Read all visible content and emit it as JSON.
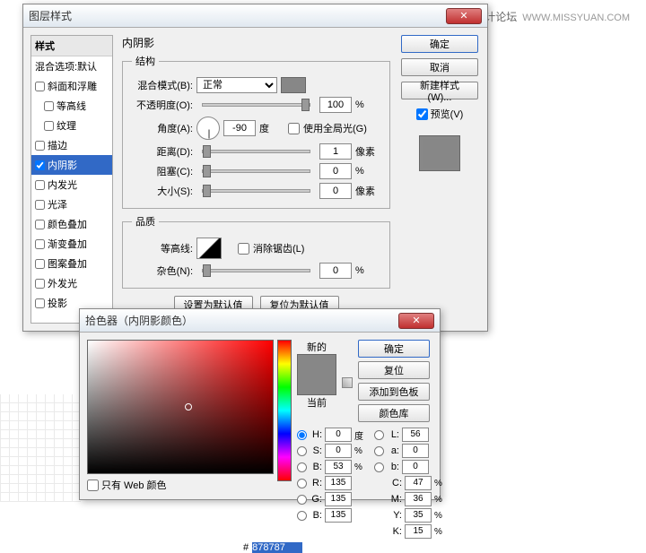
{
  "watermark": {
    "cn": "思缘设计论坛",
    "url": "WWW.MISSYUAN.COM"
  },
  "layerStyle": {
    "title": "图层样式",
    "stylesHeader": "样式",
    "items": [
      {
        "label": "混合选项:默认",
        "checked": null
      },
      {
        "label": "斜面和浮雕",
        "checked": false
      },
      {
        "label": "等高线",
        "checked": false,
        "indent": true
      },
      {
        "label": "纹理",
        "checked": false,
        "indent": true
      },
      {
        "label": "描边",
        "checked": false
      },
      {
        "label": "内阴影",
        "checked": true,
        "active": true
      },
      {
        "label": "内发光",
        "checked": false
      },
      {
        "label": "光泽",
        "checked": false
      },
      {
        "label": "颜色叠加",
        "checked": false
      },
      {
        "label": "渐变叠加",
        "checked": false
      },
      {
        "label": "图案叠加",
        "checked": false
      },
      {
        "label": "外发光",
        "checked": false
      },
      {
        "label": "投影",
        "checked": false
      }
    ],
    "panelTitle": "内阴影",
    "structure": {
      "legend": "结构",
      "blendMode": {
        "label": "混合模式(B):",
        "value": "正常"
      },
      "opacity": {
        "label": "不透明度(O):",
        "value": "100",
        "unit": "%"
      },
      "angle": {
        "label": "角度(A):",
        "value": "-90",
        "unit": "度",
        "globalLabel": "使用全局光(G)"
      },
      "distance": {
        "label": "距离(D):",
        "value": "1",
        "unit": "像素"
      },
      "choke": {
        "label": "阻塞(C):",
        "value": "0",
        "unit": "%"
      },
      "size": {
        "label": "大小(S):",
        "value": "0",
        "unit": "像素"
      }
    },
    "quality": {
      "legend": "品质",
      "contour": {
        "label": "等高线:",
        "antiAlias": "消除锯齿(L)"
      },
      "noise": {
        "label": "杂色(N):",
        "value": "0",
        "unit": "%"
      }
    },
    "defaults": {
      "set": "设置为默认值",
      "reset": "复位为默认值"
    },
    "buttons": {
      "ok": "确定",
      "cancel": "取消",
      "newStyle": "新建样式(W)...",
      "preview": "预览(V)"
    }
  },
  "colorPicker": {
    "title": "拾色器（内阴影颜色）",
    "newLabel": "新的",
    "currentLabel": "当前",
    "buttons": {
      "ok": "确定",
      "reset": "复位",
      "addSwatch": "添加到色板",
      "colorLib": "颜色库"
    },
    "hsb": {
      "h": {
        "v": "0",
        "u": "度"
      },
      "s": {
        "v": "0",
        "u": "%"
      },
      "b": {
        "v": "53",
        "u": "%"
      }
    },
    "lab": {
      "l": {
        "v": "56"
      },
      "a": {
        "v": "0"
      },
      "b": {
        "v": "0"
      }
    },
    "rgb": {
      "r": "135",
      "g": "135",
      "b": "135"
    },
    "cmyk": {
      "c": {
        "v": "47",
        "u": "%"
      },
      "m": {
        "v": "36",
        "u": "%"
      },
      "y": {
        "v": "35",
        "u": "%"
      },
      "k": {
        "v": "15",
        "u": "%"
      }
    },
    "hex": "878787",
    "webOnly": "只有 Web 颜色"
  }
}
